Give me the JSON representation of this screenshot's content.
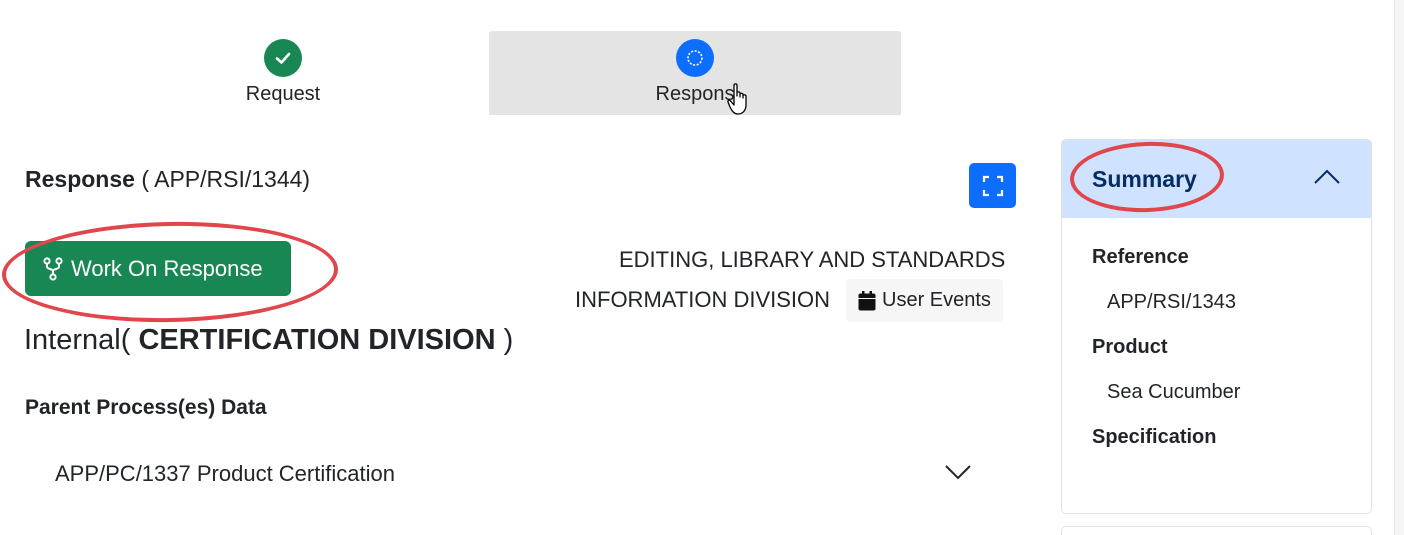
{
  "stepper": {
    "steps": [
      {
        "label": "Request",
        "status": "complete"
      },
      {
        "label": "Respons",
        "status": "active"
      }
    ]
  },
  "response": {
    "title_bold": "Response",
    "reference": "( APP/RSI/1344)"
  },
  "actions": {
    "work_on_response": "Work On Response",
    "user_events": "User Events"
  },
  "division": {
    "line1": "EDITING, LIBRARY AND STANDARDS",
    "line2": "INFORMATION DIVISION"
  },
  "internal": {
    "prefix": "Internal(",
    "name": "CERTIFICATION DIVISION",
    "suffix": ")"
  },
  "parent_process": {
    "heading": "Parent Process(es) Data",
    "items": [
      "APP/PC/1337 Product Certification"
    ]
  },
  "summary": {
    "title": "Summary",
    "fields": [
      {
        "label": "Reference",
        "value": "APP/RSI/1343"
      },
      {
        "label": "Product",
        "value": "Sea Cucumber"
      },
      {
        "label": "Specification",
        "value": ""
      }
    ]
  },
  "colors": {
    "success": "#198754",
    "primary": "#0d6efd",
    "summary_header": "#cfe2ff",
    "annotation": "#e0464b"
  }
}
